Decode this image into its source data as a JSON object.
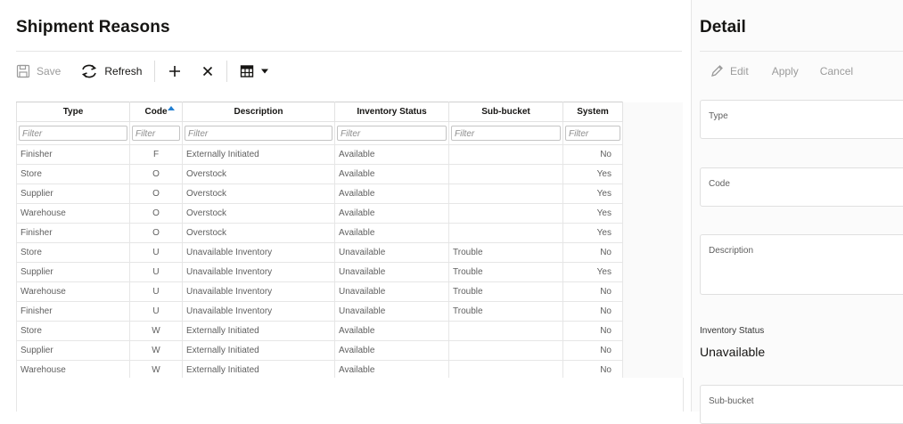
{
  "main": {
    "title": "Shipment Reasons",
    "toolbar": {
      "save_label": "Save",
      "refresh_label": "Refresh"
    },
    "columns": [
      {
        "label": "Type",
        "sorted": false
      },
      {
        "label": "Code",
        "sorted": true,
        "sort_direction": "ascending"
      },
      {
        "label": "Description",
        "sorted": false
      },
      {
        "label": "Inventory Status",
        "sorted": false
      },
      {
        "label": "Sub-bucket",
        "sorted": false
      },
      {
        "label": "System",
        "sorted": false
      }
    ],
    "filter_placeholder": "Filter",
    "rows": [
      {
        "type": "Finisher",
        "code": "F",
        "description": "Externally Initiated",
        "inventory_status": "Available",
        "sub_bucket": "",
        "system": "No"
      },
      {
        "type": "Store",
        "code": "O",
        "description": "Overstock",
        "inventory_status": "Available",
        "sub_bucket": "",
        "system": "Yes"
      },
      {
        "type": "Supplier",
        "code": "O",
        "description": "Overstock",
        "inventory_status": "Available",
        "sub_bucket": "",
        "system": "Yes"
      },
      {
        "type": "Warehouse",
        "code": "O",
        "description": "Overstock",
        "inventory_status": "Available",
        "sub_bucket": "",
        "system": "Yes"
      },
      {
        "type": "Finisher",
        "code": "O",
        "description": "Overstock",
        "inventory_status": "Available",
        "sub_bucket": "",
        "system": "Yes"
      },
      {
        "type": "Store",
        "code": "U",
        "description": "Unavailable Inventory",
        "inventory_status": "Unavailable",
        "sub_bucket": "Trouble",
        "system": "No"
      },
      {
        "type": "Supplier",
        "code": "U",
        "description": "Unavailable Inventory",
        "inventory_status": "Unavailable",
        "sub_bucket": "Trouble",
        "system": "Yes"
      },
      {
        "type": "Warehouse",
        "code": "U",
        "description": "Unavailable Inventory",
        "inventory_status": "Unavailable",
        "sub_bucket": "Trouble",
        "system": "No"
      },
      {
        "type": "Finisher",
        "code": "U",
        "description": "Unavailable Inventory",
        "inventory_status": "Unavailable",
        "sub_bucket": "Trouble",
        "system": "No"
      },
      {
        "type": "Store",
        "code": "W",
        "description": "Externally Initiated",
        "inventory_status": "Available",
        "sub_bucket": "",
        "system": "No"
      },
      {
        "type": "Supplier",
        "code": "W",
        "description": "Externally Initiated",
        "inventory_status": "Available",
        "sub_bucket": "",
        "system": "No"
      },
      {
        "type": "Warehouse",
        "code": "W",
        "description": "Externally Initiated",
        "inventory_status": "Available",
        "sub_bucket": "",
        "system": "No"
      }
    ]
  },
  "detail": {
    "title": "Detail",
    "toolbar": {
      "edit_label": "Edit",
      "apply_label": "Apply",
      "cancel_label": "Cancel"
    },
    "fields": {
      "type_label": "Type",
      "code_label": "Code",
      "description_label": "Description",
      "inventory_status_label": "Inventory Status",
      "inventory_status_value": "Unavailable",
      "sub_bucket_label": "Sub-bucket"
    }
  },
  "colors": {
    "accent": "#227fd1",
    "text_primary": "#161513",
    "text_secondary": "#5f5f5f",
    "disabled": "#9b9b9b"
  },
  "icons": {
    "save": "save-icon",
    "refresh": "refresh-icon",
    "add": "add-icon",
    "delete": "delete-icon",
    "grid_menu": "table-icon",
    "edit": "pencil-icon"
  }
}
